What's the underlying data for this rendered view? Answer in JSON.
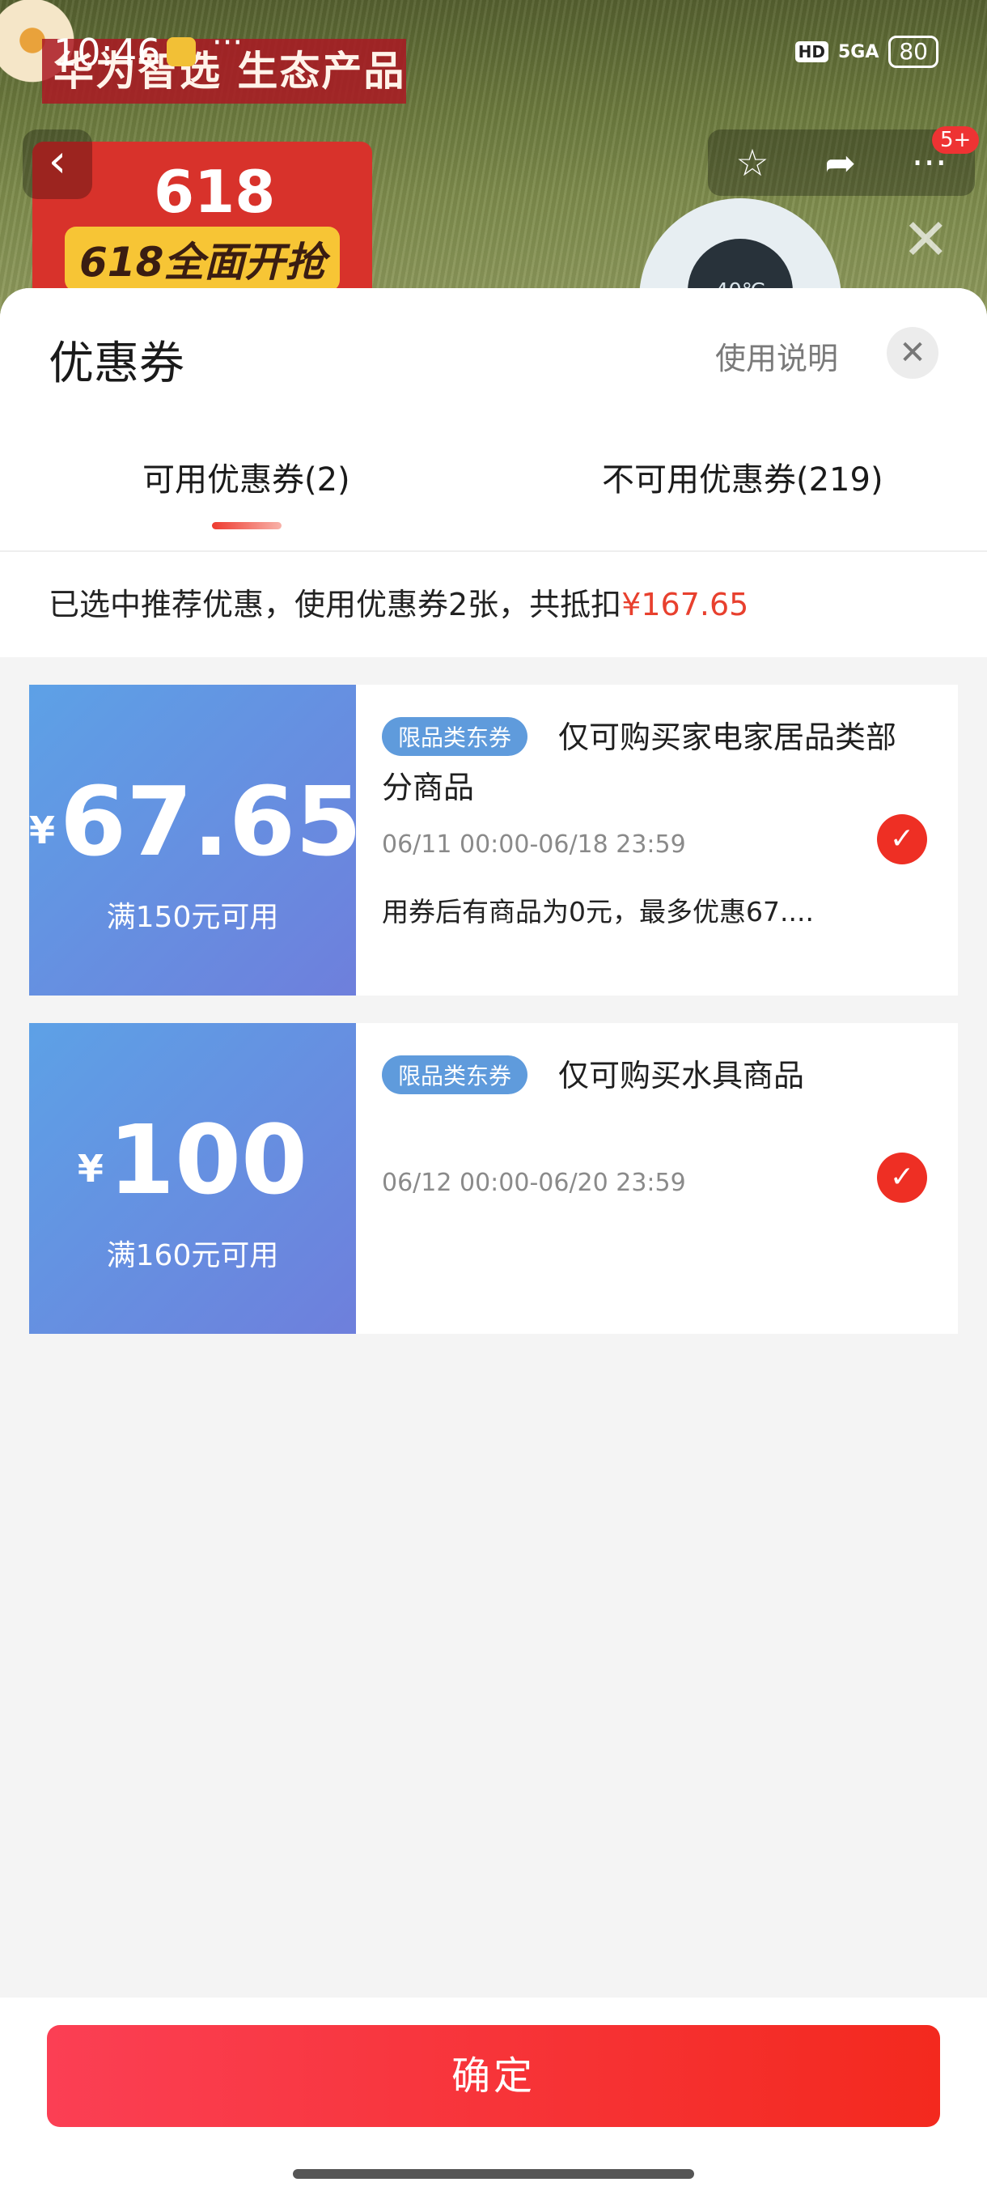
{
  "status_bar": {
    "time": "10:46",
    "overflow": "···",
    "hd": "HD",
    "signal": "5GA",
    "battery": "80"
  },
  "background": {
    "banner": "华为智选 生态产品",
    "promo_number": "618",
    "promo_text": "618全面开抢",
    "heater_temp": "40℃",
    "badge": "5+",
    "icons": {
      "back": "back-arrow-icon",
      "favorite": "star-icon",
      "share": "share-icon",
      "more": "more-icon"
    }
  },
  "sheet": {
    "title": "优惠券",
    "help_label": "使用说明",
    "close_icon": "close-icon",
    "tabs": [
      {
        "label": "可用优惠券(2)",
        "active": true
      },
      {
        "label": "不可用优惠券(219)",
        "active": false
      }
    ],
    "summary": {
      "text": "已选中推荐优惠，使用优惠券2张，共抵扣",
      "amount": "¥167.65"
    },
    "coupons": [
      {
        "currency": "¥",
        "amount": "67.65",
        "condition": "满150元可用",
        "tag": "限品类东券",
        "title": "仅可购买家电家居品类部分商品",
        "validity": "06/11 00:00-06/18 23:59",
        "description": "用券后有商品为0元，最多优惠67....",
        "selected": true
      },
      {
        "currency": "¥",
        "amount": "100",
        "condition": "满160元可用",
        "tag": "限品类东券",
        "title": "仅可购买水具商品",
        "validity": "06/12 00:00-06/20 23:59",
        "description": "",
        "selected": true
      }
    ],
    "confirm_label": "确定"
  },
  "colors": {
    "accent_red": "#ee2f24",
    "coupon_blue": "#5f9bdc",
    "confirm_start": "#fb3f54",
    "confirm_end": "#f3291e"
  }
}
